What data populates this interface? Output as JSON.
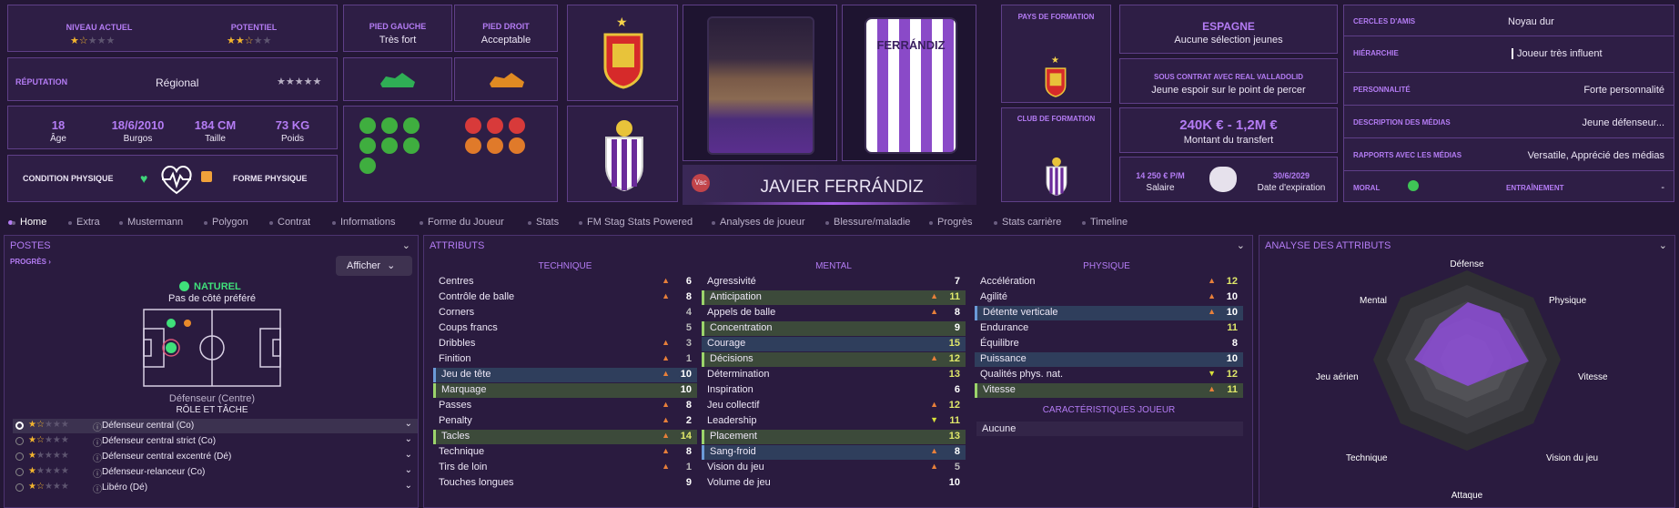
{
  "header": {
    "level": {
      "label": "NIVEAU ACTUEL",
      "stars": 1.5
    },
    "potential": {
      "label": "POTENTIEL",
      "stars": 2.5
    },
    "reputation": {
      "label": "RÉPUTATION",
      "value": "Régional",
      "stars": 0
    },
    "age": {
      "value": "18",
      "label": "Âge"
    },
    "birth": {
      "value": "18/6/2010",
      "label": "Burgos"
    },
    "height": {
      "value": "184 CM",
      "label": "Taille"
    },
    "weight": {
      "value": "73 KG",
      "label": "Poids"
    },
    "condition": "CONDITION PHYSIQUE",
    "form": "FORME PHYSIQUE",
    "left_foot": {
      "label": "PIED GAUCHE",
      "value": "Très fort"
    },
    "right_foot": {
      "label": "PIED DROIT",
      "value": "Acceptable"
    },
    "player_name": "JAVIER FERRÁNDIZ",
    "vac": "Vac",
    "shirt_name": "FERRÁNDIZ",
    "training_nation": "PAYS DE FORMATION",
    "training_club": "CLUB DE FORMATION",
    "nation": {
      "name": "ESPAGNE",
      "sub": "Aucune sélection jeunes"
    },
    "contract": {
      "title": "SOUS CONTRAT AVEC REAL VALLADOLID",
      "sub": "Jeune espoir sur le point de percer"
    },
    "transfer": {
      "value": "240K € - 1,2M €",
      "label": "Montant du transfert"
    },
    "salary": {
      "value": "14 250 € P/M",
      "label": "Salaire"
    },
    "expiry": {
      "value": "30/6/2029",
      "label": "Date d'expiration"
    },
    "info": [
      {
        "label": "CERCLES D'AMIS",
        "value": "Noyau dur"
      },
      {
        "label": "HIÉRARCHIE",
        "value": "Joueur très influent"
      },
      {
        "label": "PERSONNALITÉ",
        "value": "Forte personnalité"
      },
      {
        "label": "DESCRIPTION DES MÉDIAS",
        "value": "Jeune défenseur..."
      },
      {
        "label": "RAPPORTS AVEC LES MÉDIAS",
        "value": "Versatile, Apprécié des médias"
      }
    ],
    "morale": "MORAL",
    "training": "ENTRAÎNEMENT",
    "training_value": "-"
  },
  "tabs": [
    "Home",
    "Extra",
    "Mustermann",
    "Polygon",
    "Contrat",
    "Informations",
    "Forme du Joueur",
    "Stats",
    "FM Stag Stats Powered",
    "Analyses de joueur",
    "Blessure/maladie",
    "Progrès",
    "Stats carrière",
    "Timeline"
  ],
  "positions": {
    "title": "POSTES",
    "progress": "PROGRÈS",
    "show_button": "Afficher",
    "natural": "NATUREL",
    "foot_pref": "Pas de côté préféré",
    "selected_role": "Défenseur (Centre)",
    "role_title": "RÔLE ET TÂCHE",
    "roles": [
      {
        "name": "Défenseur central (Co)",
        "stars": 1.5
      },
      {
        "name": "Défenseur central strict (Co)",
        "stars": 1.5
      },
      {
        "name": "Défenseur central excentré (Dé)",
        "stars": 1
      },
      {
        "name": "Défenseur-relanceur (Co)",
        "stars": 1
      },
      {
        "name": "Libéro (Dé)",
        "stars": 1.5
      }
    ]
  },
  "attributes": {
    "title": "ATTRIBUTS",
    "technical_title": "TECHNIQUE",
    "mental_title": "MENTAL",
    "physical_title": "PHYSIQUE",
    "traits_title": "CARACTÉRISTIQUES JOUEUR",
    "traits_value": "Aucune",
    "technical": [
      {
        "name": "Centres",
        "value": "6"
      },
      {
        "name": "Contrôle de balle",
        "value": "8"
      },
      {
        "name": "Corners",
        "value": "4"
      },
      {
        "name": "Coups francs",
        "value": "5"
      },
      {
        "name": "Dribbles",
        "value": "3"
      },
      {
        "name": "Finition",
        "value": "1"
      },
      {
        "name": "Jeu de tête",
        "value": "10"
      },
      {
        "name": "Marquage",
        "value": "10"
      },
      {
        "name": "Passes",
        "value": "8"
      },
      {
        "name": "Penalty",
        "value": "2"
      },
      {
        "name": "Tacles",
        "value": "14"
      },
      {
        "name": "Technique",
        "value": "8"
      },
      {
        "name": "Tirs de loin",
        "value": "1"
      },
      {
        "name": "Touches longues",
        "value": "9"
      }
    ],
    "mental": [
      {
        "name": "Agressivité",
        "value": "7"
      },
      {
        "name": "Anticipation",
        "value": "11"
      },
      {
        "name": "Appels de balle",
        "value": "8"
      },
      {
        "name": "Concentration",
        "value": "9"
      },
      {
        "name": "Courage",
        "value": "15"
      },
      {
        "name": "Décisions",
        "value": "12"
      },
      {
        "name": "Détermination",
        "value": "13"
      },
      {
        "name": "Inspiration",
        "value": "6"
      },
      {
        "name": "Jeu collectif",
        "value": "12"
      },
      {
        "name": "Leadership",
        "value": "11"
      },
      {
        "name": "Placement",
        "value": "13"
      },
      {
        "name": "Sang-froid",
        "value": "8"
      },
      {
        "name": "Vision du jeu",
        "value": "5"
      },
      {
        "name": "Volume de jeu",
        "value": "10"
      }
    ],
    "physical": [
      {
        "name": "Accélération",
        "value": "12"
      },
      {
        "name": "Agilité",
        "value": "10"
      },
      {
        "name": "Détente verticale",
        "value": "10"
      },
      {
        "name": "Endurance",
        "value": "11"
      },
      {
        "name": "Équilibre",
        "value": "8"
      },
      {
        "name": "Puissance",
        "value": "10"
      },
      {
        "name": "Qualités phys. nat.",
        "value": "12"
      },
      {
        "name": "Vitesse",
        "value": "11"
      }
    ]
  },
  "analysis": {
    "title": "ANALYSE DES ATTRIBUTS",
    "axes": [
      "Défense",
      "Physique",
      "Vitesse",
      "Vision du jeu",
      "Attaque",
      "Technique",
      "Jeu aérien",
      "Mental"
    ]
  }
}
